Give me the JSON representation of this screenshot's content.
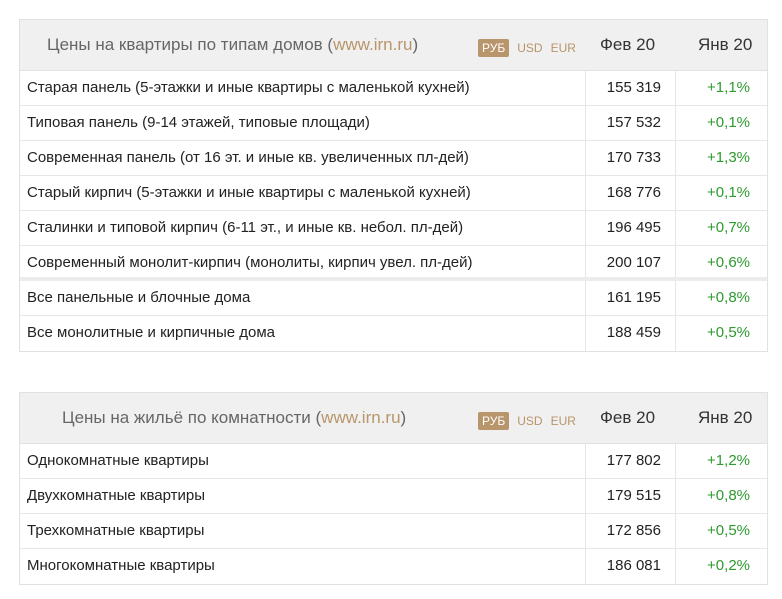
{
  "currencies": [
    "РУБ",
    "USD",
    "EUR"
  ],
  "table1": {
    "title_text": "Цены на квартиры по типам домов (",
    "title_link": "www.irn.ru",
    "title_close": ")",
    "col1": "Фев 20",
    "col2": "Янв 20",
    "rows": [
      {
        "name": "Старая панель (5-этажки и иные квартиры с маленькой кухней)",
        "value": "155 319",
        "change": "+1,1%"
      },
      {
        "name": "Типовая панель (9-14 этажей, типовые площади)",
        "value": "157 532",
        "change": "+0,1%"
      },
      {
        "name": "Современная панель (от 16 эт. и иные кв. увеличенных пл-дей)",
        "value": "170 733",
        "change": "+1,3%"
      },
      {
        "name": "Старый кирпич (5-этажки и иные квартиры с маленькой кухней)",
        "value": "168 776",
        "change": "+0,1%"
      },
      {
        "name": "Сталинки и типовой кирпич (6-11 эт., и иные кв. небол. пл-дей)",
        "value": "196 495",
        "change": "+0,7%"
      },
      {
        "name": "Современный монолит-кирпич (монолиты, кирпич увел. пл-дей)",
        "value": "200 107",
        "change": "+0,6%"
      },
      {
        "name": "Все панельные и блочные дома",
        "value": "161 195",
        "change": "+0,8%"
      },
      {
        "name": "Все монолитные и кирпичные дома",
        "value": "188 459",
        "change": "+0,5%"
      }
    ]
  },
  "table2": {
    "title_text": "Цены на жильё по комнатности (",
    "title_link": "www.irn.ru",
    "title_close": ")",
    "col1": "Фев 20",
    "col2": "Янв 20",
    "rows": [
      {
        "name": "Однокомнатные квартиры",
        "value": "177 802",
        "change": "+1,2%"
      },
      {
        "name": "Двухкомнатные квартиры",
        "value": "179 515",
        "change": "+0,8%"
      },
      {
        "name": "Трехкомнатные квартиры",
        "value": "172 856",
        "change": "+0,5%"
      },
      {
        "name": "Многокомнатные квартиры",
        "value": "186 081",
        "change": "+0,2%"
      }
    ]
  }
}
